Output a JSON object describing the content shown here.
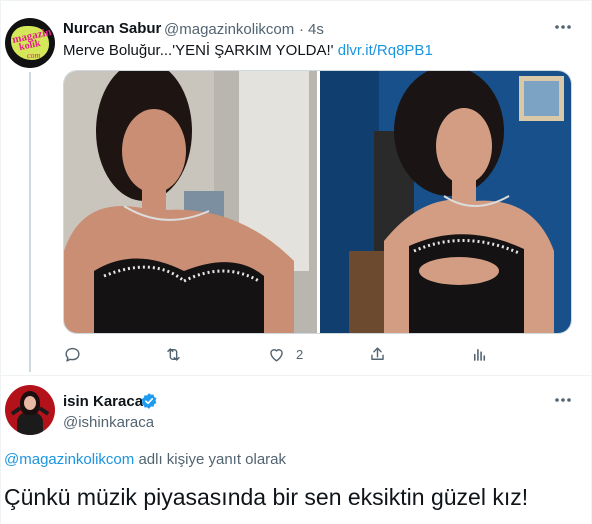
{
  "tweet1": {
    "display_name": "Nurcan Sabur",
    "handle": "@magazinkolikcom",
    "separator": "·",
    "time": "4s",
    "text": "Merve Boluğur...'YENİ ŞARKIM YOLDA!'",
    "link_text": "dlvr.it/Rq8PB1",
    "avatar_logo": {
      "line1": "magazin",
      "line2": "kolik",
      "line3": "com"
    },
    "actions": {
      "like_count": "2"
    },
    "colors": {
      "link": "#1b95e0",
      "secondary": "#536471"
    }
  },
  "tweet2": {
    "display_name": "isin Karaca",
    "handle": "@ishinkaraca",
    "reply_to_mention": "@magazinkolikcom",
    "reply_to_suffix": " adlı kişiye yanıt olarak",
    "text": "Çünkü müzik piyasasında bir sen eksiktin güzel kız!",
    "verified": true,
    "colors": {
      "verified_badge": "#1d9bf0"
    }
  },
  "icons": [
    "more-icon",
    "reply-icon",
    "retweet-icon",
    "like-icon",
    "share-icon",
    "analytics-icon",
    "verified-icon"
  ]
}
